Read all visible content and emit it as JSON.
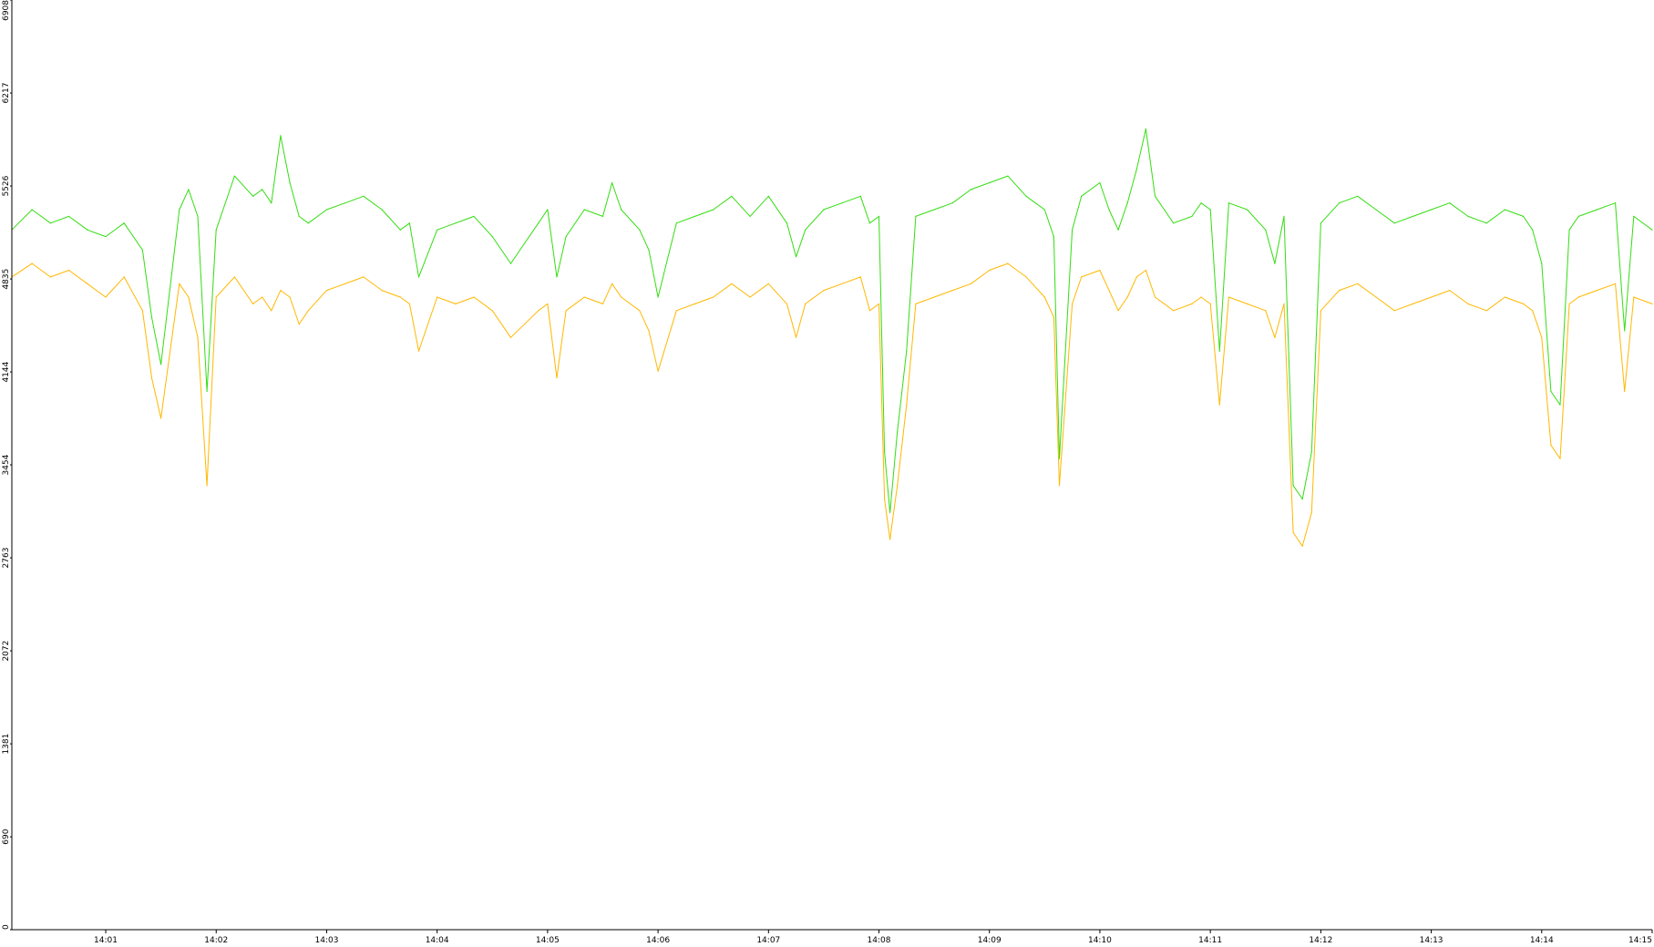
{
  "chart_data": {
    "type": "line",
    "title": "",
    "xlabel": "",
    "ylabel": "",
    "ylim": [
      0,
      6908
    ],
    "y_ticks": [
      0,
      690,
      1381,
      2072,
      2763,
      3454,
      4144,
      4835,
      5526,
      6217,
      6908
    ],
    "y_tick_labels": [
      "0",
      "690",
      "1381",
      "2072",
      "2763",
      "3454",
      "4144",
      "4835",
      "5526",
      "6217",
      "6908"
    ],
    "xlim": [
      "14:00:09",
      "14:15:00"
    ],
    "x_ticks": [
      "14:01",
      "14:02",
      "14:03",
      "14:04",
      "14:05",
      "14:06",
      "14:07",
      "14:08",
      "14:09",
      "14:10",
      "14:11",
      "14:12",
      "14:13",
      "14:14",
      "14:15"
    ],
    "x_tick_labels": [
      "14:01",
      "14:02",
      "14:03",
      "14:04",
      "14:05",
      "14:06",
      "14:07",
      "14:08",
      "14:09",
      "14:10",
      "14:11",
      "14:12",
      "14:13",
      "14:14",
      "14:15"
    ],
    "grid": false,
    "legend": "none",
    "series": [
      {
        "color": "#33dd11",
        "x": [
          "14:00:09",
          "14:00:20",
          "14:00:30",
          "14:00:40",
          "14:00:50",
          "14:01:00",
          "14:01:10",
          "14:01:20",
          "14:01:25",
          "14:01:30",
          "14:01:40",
          "14:01:45",
          "14:01:50",
          "14:01:55",
          "14:02:00",
          "14:02:10",
          "14:02:20",
          "14:02:25",
          "14:02:30",
          "14:02:35",
          "14:02:40",
          "14:02:45",
          "14:02:50",
          "14:03:00",
          "14:03:10",
          "14:03:20",
          "14:03:30",
          "14:03:40",
          "14:03:45",
          "14:03:50",
          "14:04:00",
          "14:04:10",
          "14:04:20",
          "14:04:30",
          "14:04:40",
          "14:04:55",
          "14:05:00",
          "14:05:05",
          "14:05:10",
          "14:05:20",
          "14:05:30",
          "14:05:35",
          "14:05:40",
          "14:05:50",
          "14:05:55",
          "14:06:00",
          "14:06:10",
          "14:06:20",
          "14:06:30",
          "14:06:40",
          "14:06:50",
          "14:07:00",
          "14:07:10",
          "14:07:15",
          "14:07:20",
          "14:07:30",
          "14:07:40",
          "14:07:50",
          "14:07:55",
          "14:08:00",
          "14:08:03",
          "14:08:06",
          "14:08:10",
          "14:08:15",
          "14:08:20",
          "14:08:30",
          "14:08:40",
          "14:08:50",
          "14:09:00",
          "14:09:10",
          "14:09:20",
          "14:09:30",
          "14:09:35",
          "14:09:38",
          "14:09:45",
          "14:09:50",
          "14:10:00",
          "14:10:05",
          "14:10:10",
          "14:10:15",
          "14:10:20",
          "14:10:25",
          "14:10:30",
          "14:10:35",
          "14:10:40",
          "14:10:50",
          "14:10:55",
          "14:11:00",
          "14:11:05",
          "14:11:10",
          "14:11:20",
          "14:11:30",
          "14:11:35",
          "14:11:40",
          "14:11:45",
          "14:11:50",
          "14:11:55",
          "14:12:00",
          "14:12:10",
          "14:12:20",
          "14:12:30",
          "14:12:40",
          "14:12:50",
          "14:13:00",
          "14:13:10",
          "14:13:20",
          "14:13:30",
          "14:13:40",
          "14:13:50",
          "14:13:55",
          "14:14:00",
          "14:14:05",
          "14:14:10",
          "14:14:15",
          "14:14:20",
          "14:14:30",
          "14:14:40",
          "14:14:45",
          "14:14:50",
          "14:15:00"
        ],
        "y": [
          5200,
          5350,
          5250,
          5300,
          5200,
          5150,
          5250,
          5050,
          4550,
          4200,
          5350,
          5500,
          5300,
          4000,
          5200,
          5600,
          5450,
          5500,
          5400,
          5900,
          5550,
          5300,
          5250,
          5350,
          5400,
          5450,
          5350,
          5200,
          5250,
          4850,
          5200,
          5250,
          5300,
          5150,
          4950,
          5250,
          5350,
          4850,
          5150,
          5350,
          5300,
          5550,
          5350,
          5200,
          5050,
          4700,
          5250,
          5300,
          5350,
          5450,
          5300,
          5450,
          5250,
          5000,
          5200,
          5350,
          5400,
          5450,
          5250,
          5300,
          3550,
          3100,
          3700,
          4300,
          5300,
          5350,
          5400,
          5500,
          5550,
          5600,
          5450,
          5350,
          5150,
          3500,
          5200,
          5450,
          5550,
          5350,
          5200,
          5400,
          5650,
          5950,
          5450,
          5350,
          5250,
          5300,
          5400,
          5350,
          4300,
          5400,
          5350,
          5200,
          4950,
          5300,
          3300,
          3200,
          3550,
          5250,
          5400,
          5450,
          5350,
          5250,
          5300,
          5350,
          5400,
          5300,
          5250,
          5350,
          5300,
          5200,
          4950,
          4000,
          3900,
          5200,
          5300,
          5350,
          5400,
          4450,
          5300,
          5200
        ]
      },
      {
        "color": "#ffb800",
        "x": [
          "14:00:09",
          "14:00:20",
          "14:00:30",
          "14:00:40",
          "14:00:50",
          "14:01:00",
          "14:01:10",
          "14:01:20",
          "14:01:25",
          "14:01:30",
          "14:01:40",
          "14:01:45",
          "14:01:50",
          "14:01:55",
          "14:02:00",
          "14:02:10",
          "14:02:20",
          "14:02:25",
          "14:02:30",
          "14:02:35",
          "14:02:40",
          "14:02:45",
          "14:02:50",
          "14:03:00",
          "14:03:10",
          "14:03:20",
          "14:03:30",
          "14:03:40",
          "14:03:45",
          "14:03:50",
          "14:04:00",
          "14:04:10",
          "14:04:20",
          "14:04:30",
          "14:04:40",
          "14:04:55",
          "14:05:00",
          "14:05:05",
          "14:05:10",
          "14:05:20",
          "14:05:30",
          "14:05:35",
          "14:05:40",
          "14:05:50",
          "14:05:55",
          "14:06:00",
          "14:06:10",
          "14:06:20",
          "14:06:30",
          "14:06:40",
          "14:06:50",
          "14:07:00",
          "14:07:10",
          "14:07:15",
          "14:07:20",
          "14:07:30",
          "14:07:40",
          "14:07:50",
          "14:07:55",
          "14:08:00",
          "14:08:03",
          "14:08:06",
          "14:08:10",
          "14:08:15",
          "14:08:20",
          "14:08:30",
          "14:08:40",
          "14:08:50",
          "14:09:00",
          "14:09:10",
          "14:09:20",
          "14:09:30",
          "14:09:35",
          "14:09:38",
          "14:09:45",
          "14:09:50",
          "14:10:00",
          "14:10:05",
          "14:10:10",
          "14:10:15",
          "14:10:20",
          "14:10:25",
          "14:10:30",
          "14:10:35",
          "14:10:40",
          "14:10:50",
          "14:10:55",
          "14:11:00",
          "14:11:05",
          "14:11:10",
          "14:11:20",
          "14:11:30",
          "14:11:35",
          "14:11:40",
          "14:11:45",
          "14:11:50",
          "14:11:55",
          "14:12:00",
          "14:12:10",
          "14:12:20",
          "14:12:30",
          "14:12:40",
          "14:12:50",
          "14:13:00",
          "14:13:10",
          "14:13:20",
          "14:13:30",
          "14:13:40",
          "14:13:50",
          "14:13:55",
          "14:14:00",
          "14:14:05",
          "14:14:10",
          "14:14:15",
          "14:14:20",
          "14:14:30",
          "14:14:40",
          "14:14:45",
          "14:14:50",
          "14:15:00"
        ],
        "y": [
          4850,
          4950,
          4850,
          4900,
          4800,
          4700,
          4850,
          4600,
          4100,
          3800,
          4800,
          4700,
          4400,
          3300,
          4700,
          4850,
          4650,
          4700,
          4600,
          4750,
          4700,
          4500,
          4600,
          4750,
          4800,
          4850,
          4750,
          4700,
          4650,
          4300,
          4700,
          4650,
          4700,
          4600,
          4400,
          4600,
          4650,
          4100,
          4600,
          4700,
          4650,
          4800,
          4700,
          4600,
          4450,
          4150,
          4600,
          4650,
          4700,
          4800,
          4700,
          4800,
          4650,
          4400,
          4650,
          4750,
          4800,
          4850,
          4600,
          4650,
          3200,
          2900,
          3300,
          3900,
          4650,
          4700,
          4750,
          4800,
          4900,
          4950,
          4850,
          4700,
          4550,
          3300,
          4650,
          4850,
          4900,
          4750,
          4600,
          4700,
          4850,
          4900,
          4700,
          4650,
          4600,
          4650,
          4700,
          4650,
          3900,
          4700,
          4650,
          4600,
          4400,
          4650,
          2950,
          2850,
          3100,
          4600,
          4750,
          4800,
          4700,
          4600,
          4650,
          4700,
          4750,
          4650,
          4600,
          4700,
          4650,
          4600,
          4400,
          3600,
          3500,
          4650,
          4700,
          4750,
          4800,
          4000,
          4700,
          4650
        ]
      }
    ]
  }
}
